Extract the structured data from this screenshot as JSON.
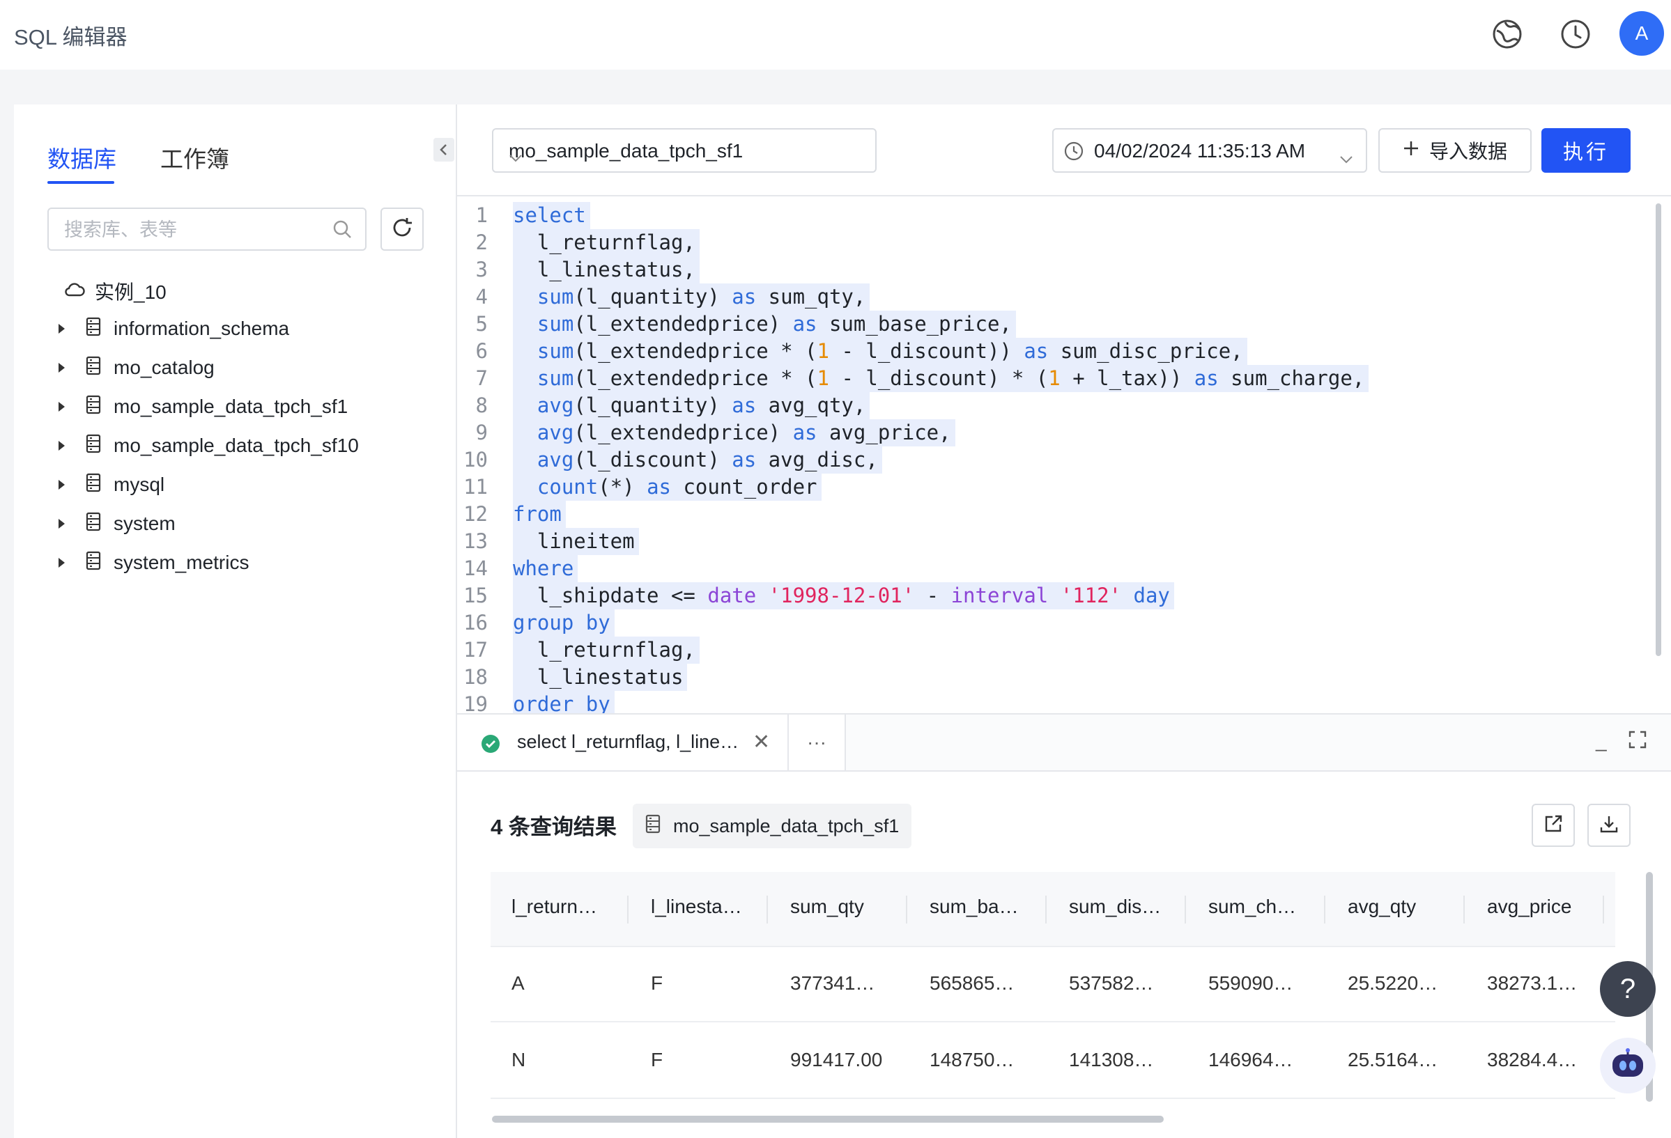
{
  "app": {
    "title": "SQL 编辑器",
    "avatar_letter": "A"
  },
  "sidebar": {
    "tabs": [
      {
        "label": "数据库",
        "active": true
      },
      {
        "label": "工作簿",
        "active": false
      }
    ],
    "search_placeholder": "搜索库、表等",
    "instance": "实例_10",
    "databases": [
      "information_schema",
      "mo_catalog",
      "mo_sample_data_tpch_sf1",
      "mo_sample_data_tpch_sf10",
      "mysql",
      "system",
      "system_metrics"
    ]
  },
  "toolbar": {
    "db_select": "mo_sample_data_tpch_sf1",
    "time_select": "04/02/2024 11:35:13 AM",
    "import_label": "导入数据",
    "run_label": "执行"
  },
  "editor": {
    "line_numbers": [
      "1",
      "2",
      "3",
      "4",
      "5",
      "6",
      "7",
      "8",
      "9",
      "10",
      "11",
      "12",
      "13",
      "14",
      "15",
      "16",
      "17",
      "18",
      "19"
    ]
  },
  "results": {
    "tab_label": "select l_returnflag, l_line…",
    "more_label": "···",
    "summary": "4 条查询结果",
    "db_tag": "mo_sample_data_tpch_sf1",
    "columns": [
      "l_return…",
      "l_linesta…",
      "sum_qty",
      "sum_ba…",
      "sum_dis…",
      "sum_ch…",
      "avg_qty",
      "avg_price"
    ],
    "rows": [
      [
        "A",
        "F",
        "377341…",
        "565865…",
        "537582…",
        "559090…",
        "25.5220…",
        "38273.1…"
      ],
      [
        "N",
        "F",
        "991417.00",
        "148750…",
        "141308…",
        "146964…",
        "25.5164…",
        "38284.4…"
      ]
    ]
  },
  "colors": {
    "accent": "#2254f4",
    "success": "#2aa876"
  }
}
